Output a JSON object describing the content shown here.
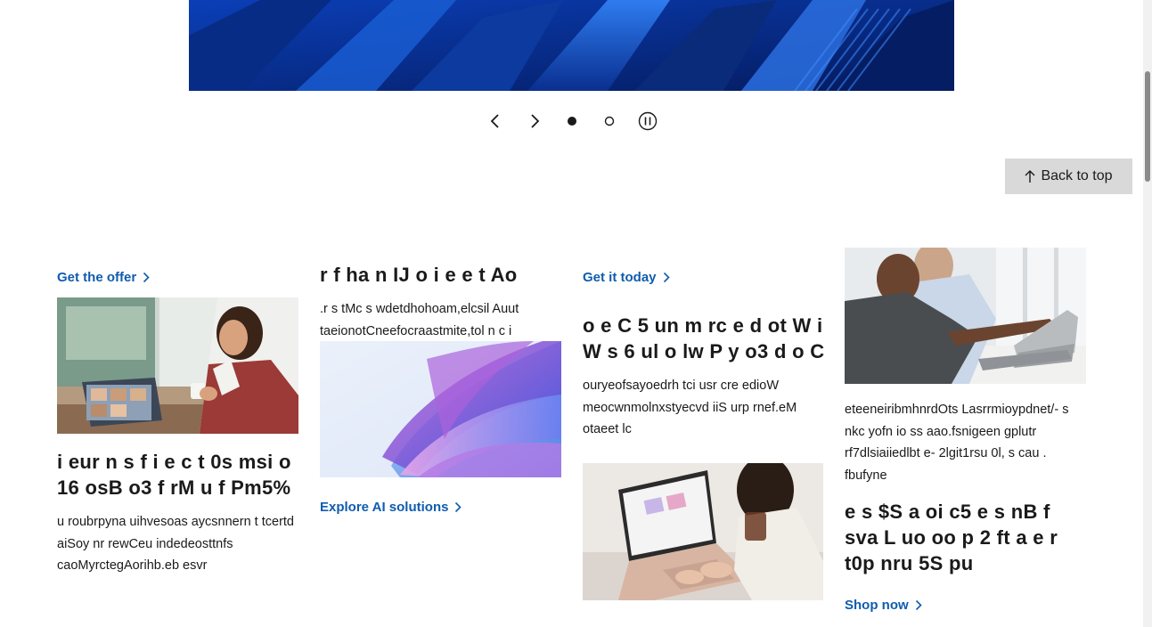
{
  "carousel": {
    "prev_icon": "chevron-left-icon",
    "next_icon": "chevron-right-icon",
    "pause_icon": "pause-icon",
    "active_slide": 1,
    "slide_count": 2
  },
  "back_to_top": {
    "label": "Back to top",
    "icon": "arrow-up-icon"
  },
  "cards": [
    {
      "link_label": "Get the offer",
      "heading": "i eur n s f i e c t 0s msi o 16 osB o3 f rM u f Pm5%",
      "body": "u roubrpyna uihvesoas aycsnnern t tcertd aiSoy nr rewCeu indedeosttnfs caoMyrctegAorihb.eb esvr"
    },
    {
      "heading": "r f ha n IJ o i e e t Ao",
      "body": ".r s tMc s wdetdhohoam,elcsil Auut taeionotCneefocraastmite,tol n c i",
      "link_label": "Explore AI solutions"
    },
    {
      "link_label": "Get it today",
      "heading": "o e C 5 un m rc e d ot W i W s 6 ul o lw P y o3 d o C",
      "body": "ouryeofsayoedrh tci usr cre edioW meocwnmolnxstyecvd iiS urp rnef.eM otaeet lc"
    },
    {
      "body": "eteeneiribmhnrdOts Lasrrmioypdnet/- s nkc yofn io ss aao.fsnigeen gplutr rf7dlsiaiiedlbt e- 2lgit1rsu 0l, s cau . fbufyne",
      "heading": "e s $S a oi c5 e s nB f sva L uo oo p 2 ft a e r t0p nru 5S pu",
      "link_label": "Shop now"
    }
  ],
  "colors": {
    "link": "#0f5cae",
    "back_to_top_bg": "#d9d9d9",
    "hero_blue": "#0a2f8f"
  }
}
